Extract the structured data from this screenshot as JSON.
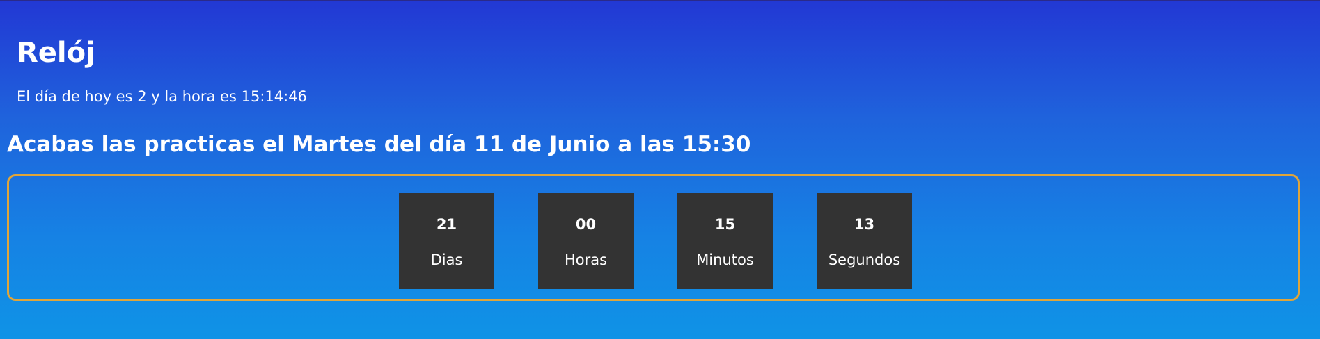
{
  "header": {
    "title": "Relój",
    "current_time_text": "El día de hoy es 2 y la hora es 15:14:46"
  },
  "deadline": {
    "text": "Acabas las practicas el Martes del día 11 de Junio a las 15:30"
  },
  "countdown": {
    "days": {
      "value": "21",
      "label": "Dias"
    },
    "hours": {
      "value": "00",
      "label": "Horas"
    },
    "minutes": {
      "value": "15",
      "label": "Minutos"
    },
    "seconds": {
      "value": "13",
      "label": "Segundos"
    }
  },
  "colors": {
    "background_top": "#2238d4",
    "background_bottom": "#0f93e6",
    "box_border": "#e0a53a",
    "unit_background": "#333333",
    "text": "#ffffff"
  }
}
